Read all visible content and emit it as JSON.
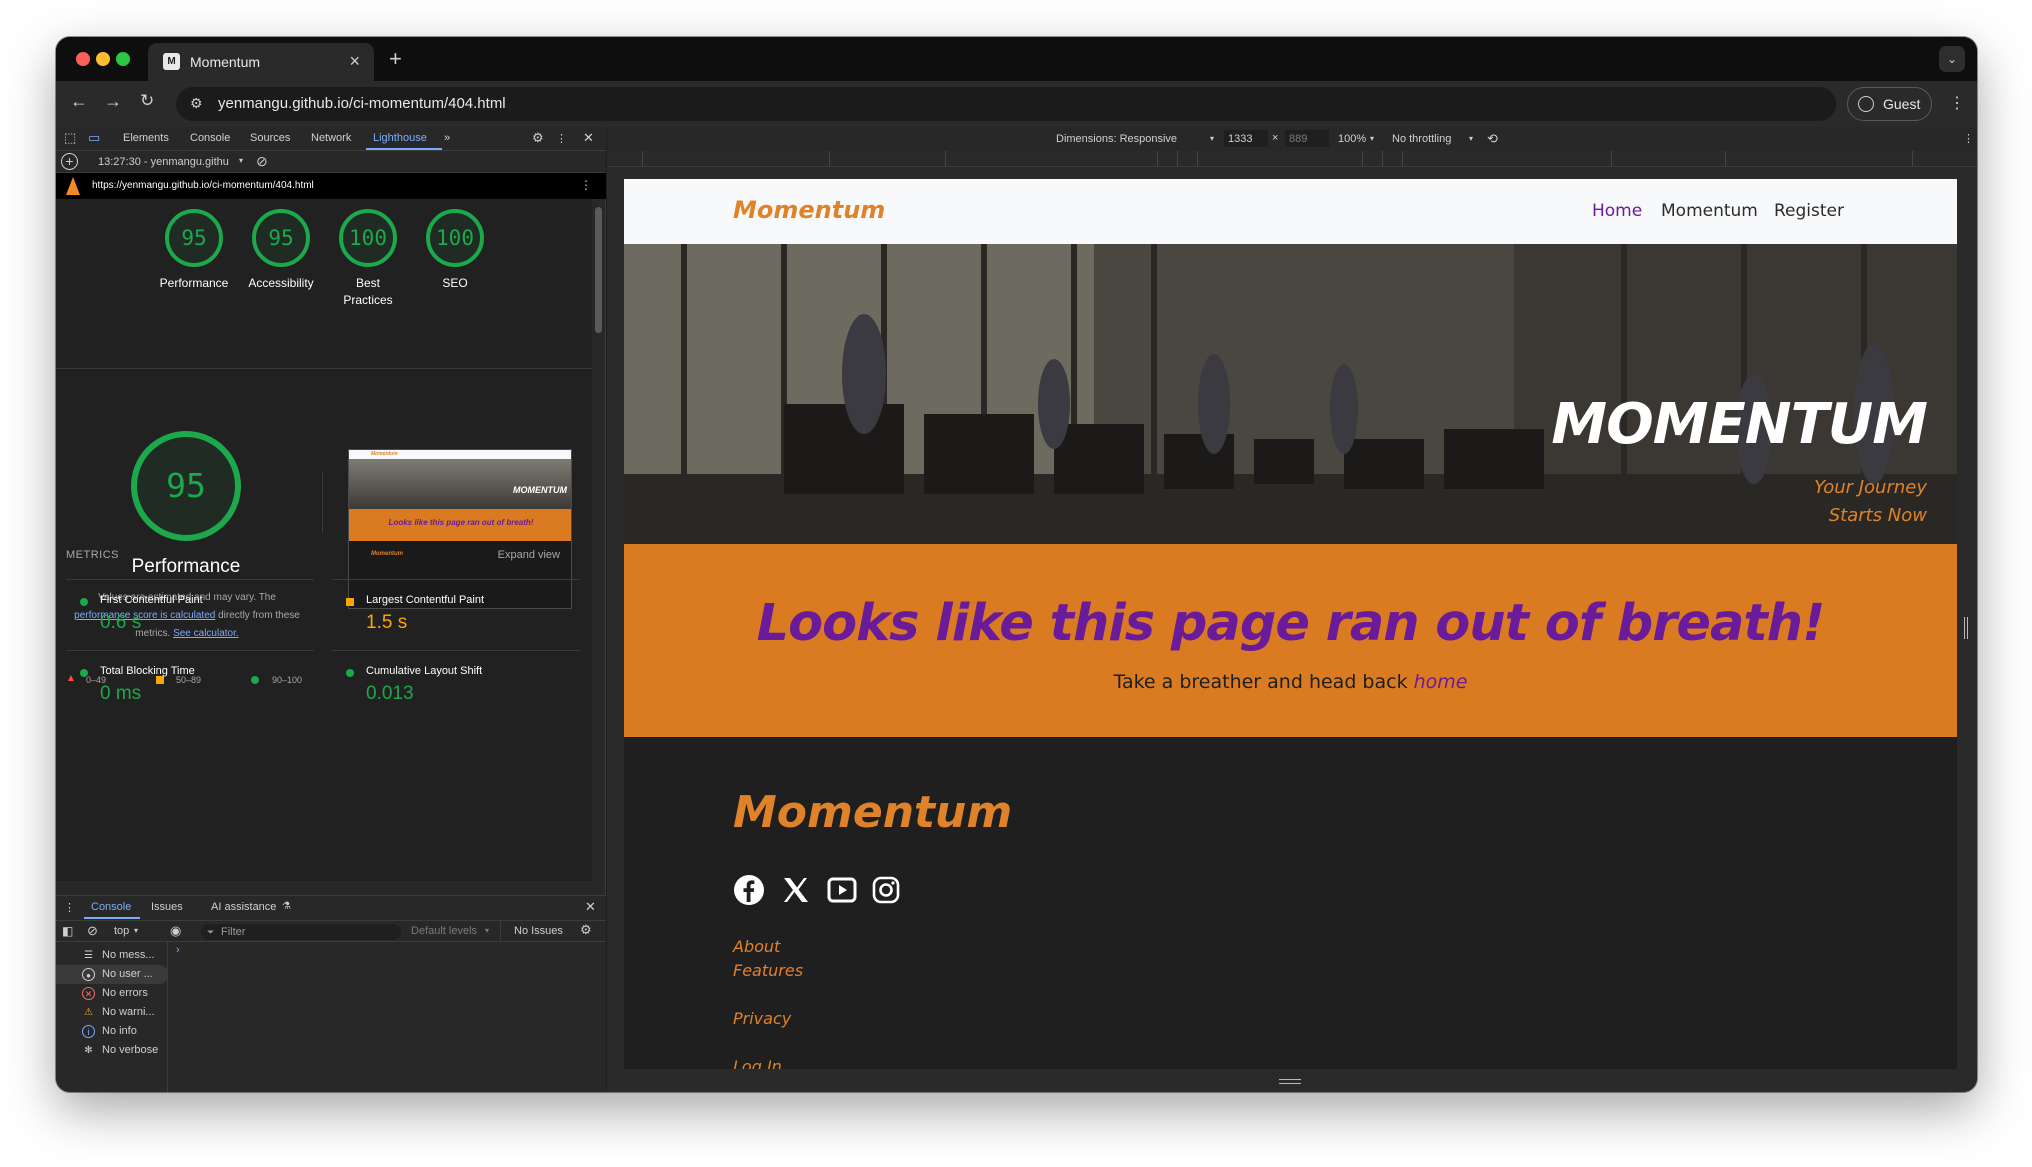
{
  "browser": {
    "tab_title": "Momentum",
    "url": "yenmangu.github.io/ci-momentum/404.html",
    "guest_label": "Guest"
  },
  "devtools": {
    "tabs": [
      "Elements",
      "Console",
      "Sources",
      "Network",
      "Lighthouse"
    ],
    "report_selector": "13:27:30 - yenmangu.githu",
    "report_url": "https://yenmangu.github.io/ci-momentum/404.html",
    "scores": [
      {
        "value": "95",
        "label": "Performance"
      },
      {
        "value": "95",
        "label": "Accessibility"
      },
      {
        "value": "100",
        "label": "Best Practices"
      },
      {
        "value": "100",
        "label": "SEO"
      }
    ],
    "performance": {
      "score": "95",
      "title": "Performance",
      "note_prefix": "Values are estimated and may vary. The",
      "note_link1": "performance score is calculated",
      "note_mid": "directly from these metrics.",
      "note_link2": "See calculator."
    },
    "legend": [
      "0–49",
      "50–89",
      "90–100"
    ],
    "metrics_header": "METRICS",
    "expand_view": "Expand view",
    "metrics": [
      {
        "name": "First Contentful Paint",
        "value": "0.6 s",
        "status": "good"
      },
      {
        "name": "Largest Contentful Paint",
        "value": "1.5 s",
        "status": "average"
      },
      {
        "name": "Total Blocking Time",
        "value": "0 ms",
        "status": "good"
      },
      {
        "name": "Cumulative Layout Shift",
        "value": "0.013",
        "status": "good"
      }
    ],
    "thumbnail": {
      "brand": "Momentum",
      "hero": "MOMENTUM",
      "heading": "Looks like this page ran out of breath!",
      "footer_brand": "Momentum"
    }
  },
  "drawer": {
    "tabs": [
      "Console",
      "Issues",
      "AI assistance"
    ],
    "context": "top",
    "filter_placeholder": "Filter",
    "levels": "Default levels",
    "issues": "No Issues",
    "sidebar": [
      {
        "icon": "list-icon",
        "label": "No mess..."
      },
      {
        "icon": "user-icon",
        "label": "No user ..."
      },
      {
        "icon": "error-icon",
        "label": "No errors"
      },
      {
        "icon": "warning-icon",
        "label": "No warni..."
      },
      {
        "icon": "info-icon",
        "label": "No info"
      },
      {
        "icon": "bug-icon",
        "label": "No verbose"
      }
    ]
  },
  "device": {
    "dimensions_label": "Dimensions: Responsive",
    "width": "1333",
    "height": "889",
    "zoom": "100%",
    "throttling": "No throttling"
  },
  "site": {
    "brand": "Momentum",
    "nav": [
      "Home",
      "Momentum",
      "Register"
    ],
    "hero_title": "MOMENTUM",
    "hero_sub_line1": "Your Journey",
    "hero_sub_line2": "Starts Now",
    "error_heading": "Looks like this page ran out of breath!",
    "error_text": "Take a breather and head back",
    "error_link": "home",
    "footer_brand": "Momentum",
    "social": [
      "facebook-icon",
      "x-icon",
      "youtube-icon",
      "instagram-icon"
    ],
    "footer_links": [
      "About",
      "Features",
      "Privacy",
      "Log In"
    ]
  },
  "colors": {
    "accent_orange": "#da7b22",
    "brand_purple": "#6a1b9a",
    "score_green": "#1ba94c",
    "devtools_blue": "#7cacf8"
  }
}
